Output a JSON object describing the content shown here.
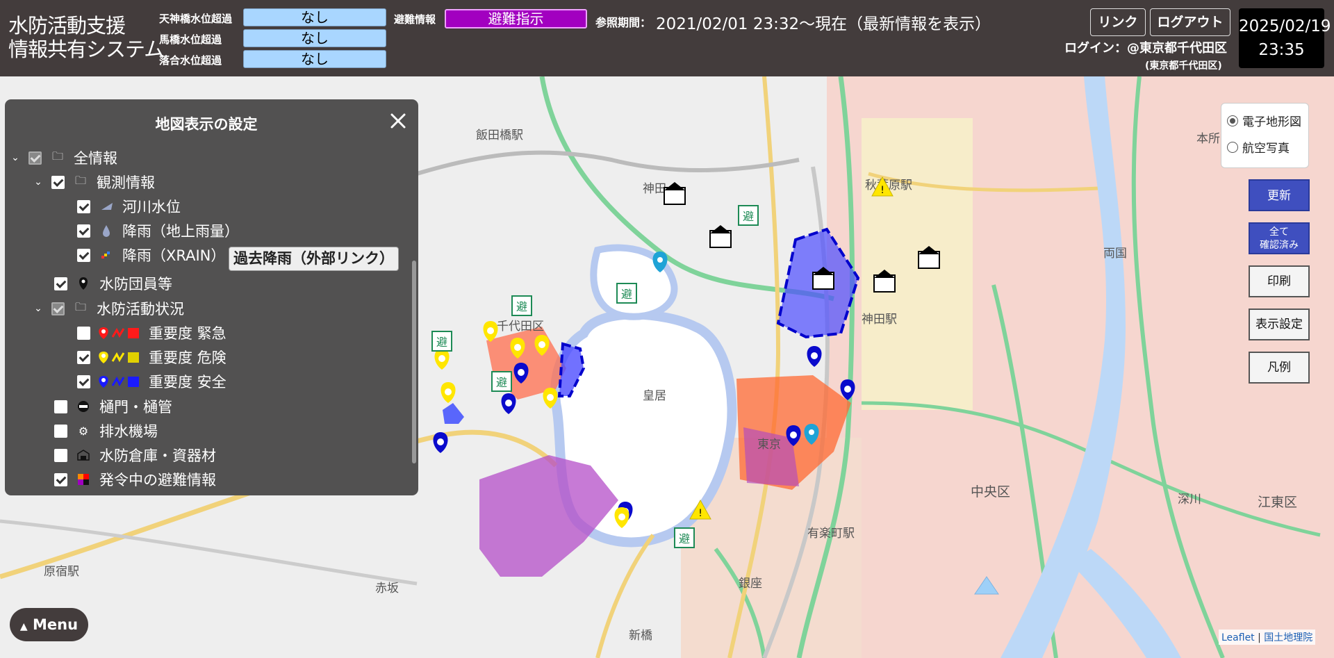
{
  "header": {
    "app_title_line1": "水防活動支援",
    "app_title_line2": "情報共有システム",
    "water_levels": [
      {
        "label": "天神橋水位超過",
        "value": "なし"
      },
      {
        "label": "馬橋水位超過",
        "value": "なし"
      },
      {
        "label": "落合水位超過",
        "value": "なし"
      }
    ],
    "evac_label": "避難情報",
    "evac_value": "避難指示",
    "period_label": "参照期間：",
    "period_value": "2021/02/01 23:32～現在（最新情報を表示）",
    "link_button": "リンク",
    "logout_button": "ログアウト",
    "login_text": "ログイン：@東京都千代田区",
    "login_sub": "(東京都千代田区)",
    "clock_date": "2025/02/19",
    "clock_time": "23:35"
  },
  "panel": {
    "title": "地図表示の設定",
    "items": [
      {
        "label": "全情報"
      },
      {
        "label": "観測情報"
      },
      {
        "label": "河川水位"
      },
      {
        "label": "降雨（地上雨量）"
      },
      {
        "label": "降雨（XRAIN）"
      },
      {
        "label": "水防団員等"
      },
      {
        "label": "水防活動状況"
      },
      {
        "label": "重要度 緊急"
      },
      {
        "label": "重要度 危険"
      },
      {
        "label": "重要度 安全"
      },
      {
        "label": "樋門・樋管"
      },
      {
        "label": "排水機場"
      },
      {
        "label": "水防倉庫・資器材"
      },
      {
        "label": "発令中の避難情報"
      }
    ],
    "xrain_link": "過去降雨（外部リンク）"
  },
  "map_controls": {
    "basemap_options": [
      "電子地形図",
      "航空写真"
    ],
    "refresh": "更新",
    "confirm_all_line1": "全て",
    "confirm_all_line2": "確認済み",
    "print": "印刷",
    "display_settings": "表示設定",
    "legend": "凡例",
    "menu": "Menu",
    "attribution_leaflet": "Leaflet",
    "attribution_gsi": "国土地理院"
  },
  "map_labels": {
    "iidabashi": "飯田橋駅",
    "kanda": "神田",
    "chiyoda": "千代田区",
    "kokyo": "皇居",
    "akasaka": "赤坂",
    "harajuku": "原宿駅",
    "shinbashi": "新橋",
    "ginza": "銀座",
    "chuo": "中央区",
    "koto": "江東区",
    "fukagawa": "深川",
    "ryogoku": "両国",
    "honjo": "本所",
    "kandaeki": "神田駅",
    "akihabara": "秋葉原駅",
    "yurakucho": "有楽町駅",
    "tokyo": "東京"
  },
  "colors": {
    "header_bg": "#433c3c",
    "panel_bg": "#525151",
    "water_level_bg": "#a9d6ff",
    "evac_bg": "#a200c0",
    "button_blue": "#3f4fbf"
  }
}
